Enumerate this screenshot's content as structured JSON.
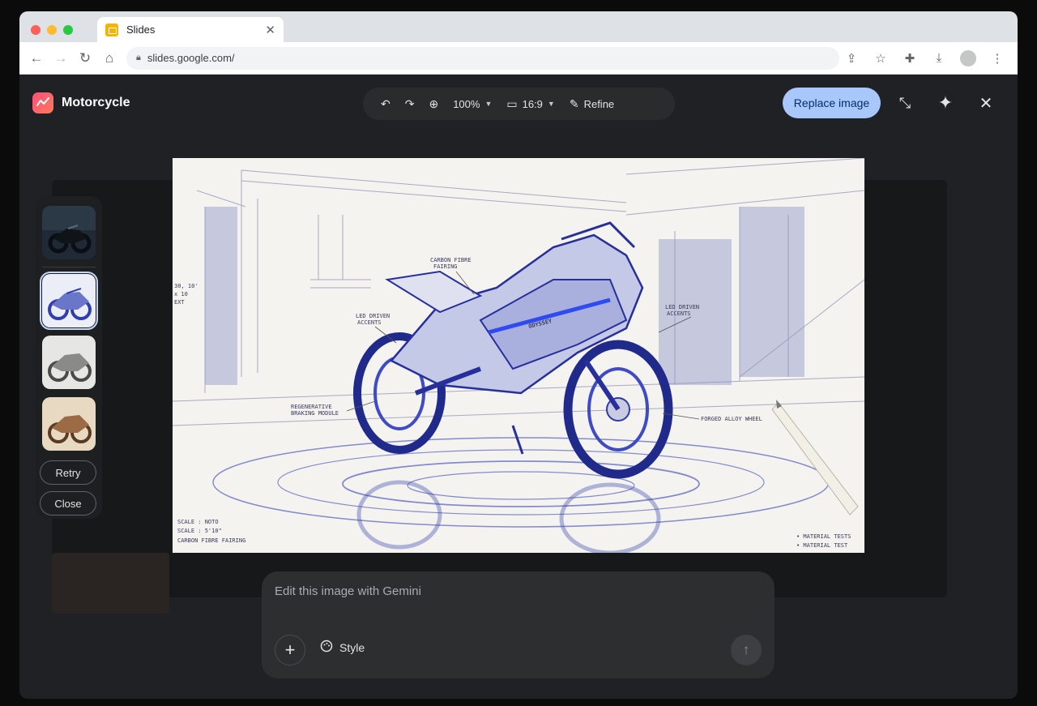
{
  "browser": {
    "tab_title": "Slides",
    "tab_close": "✕",
    "url": "slides.google.com/",
    "dots": [
      "#ff5f57",
      "#febc2e",
      "#28c840"
    ]
  },
  "app": {
    "title": "Motorcycle",
    "toolbar": {
      "zoom": "100%",
      "aspect": "16:9",
      "refine": "Refine"
    },
    "replace_label": "Replace image"
  },
  "rail": {
    "retry_label": "Retry",
    "close_label": "Close"
  },
  "sketch_labels": {
    "carbon": [
      "CARBON FIBRE",
      "FAIRING"
    ],
    "led_left": [
      "LED DRIVEN",
      "ACCENTS"
    ],
    "led_right": [
      "LED DRIVEN",
      "ACCENTS"
    ],
    "regen": [
      "REGENERATIVE",
      "BRAKING MODULE"
    ],
    "wheel": "FORGED ALLOY WHEEL",
    "brand": "ODYSSEY",
    "dims": [
      "30, 10'",
      "x 10",
      "EXT"
    ],
    "scale": [
      "SCALE : NOTO",
      "SCALE : 5'10\"",
      "CARBON FIBRE FAIRING"
    ],
    "notes": [
      "• MATERIAL TESTS",
      "• MATERIAL TEST"
    ]
  },
  "prompt": {
    "placeholder": "Edit this image with Gemini",
    "style_label": "Style"
  },
  "colors": {
    "accent": "#a8c7fa",
    "ink": "#2c3aa8"
  }
}
